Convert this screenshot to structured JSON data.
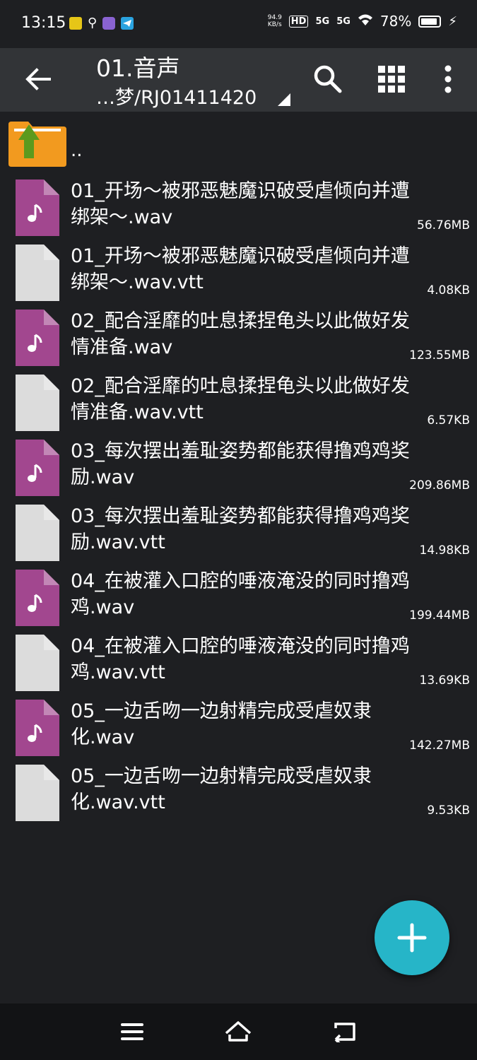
{
  "status_bar": {
    "time": "13:15",
    "net_speed_value": "94.9",
    "net_speed_unit": "KB/s",
    "hd_label": "HD",
    "sim1_label": "5G",
    "sim2_label": "5G",
    "battery": "78%"
  },
  "toolbar": {
    "title": "01.音声",
    "path": "…梦/RJ01411420"
  },
  "parent_dir": {
    "label": ".."
  },
  "files": [
    {
      "type": "audio",
      "name": "01_开场～被邪恶魅魔识破受虐倾向并遭绑架～.wav",
      "size": "56.76MB"
    },
    {
      "type": "text",
      "name": "01_开场～被邪恶魅魔识破受虐倾向并遭绑架～.wav.vtt",
      "size": "4.08KB"
    },
    {
      "type": "audio",
      "name": "02_配合淫靡的吐息揉捏龟头以此做好发情准备.wav",
      "size": "123.55MB"
    },
    {
      "type": "text",
      "name": "02_配合淫靡的吐息揉捏龟头以此做好发情准备.wav.vtt",
      "size": "6.57KB"
    },
    {
      "type": "audio",
      "name": "03_每次摆出羞耻姿势都能获得撸鸡鸡奖励.wav",
      "size": "209.86MB"
    },
    {
      "type": "text",
      "name": "03_每次摆出羞耻姿势都能获得撸鸡鸡奖励.wav.vtt",
      "size": "14.98KB"
    },
    {
      "type": "audio",
      "name": "04_在被灌入口腔的唾液淹没的同时撸鸡鸡.wav",
      "size": "199.44MB"
    },
    {
      "type": "text",
      "name": "04_在被灌入口腔的唾液淹没的同时撸鸡鸡.wav.vtt",
      "size": "13.69KB"
    },
    {
      "type": "audio",
      "name": "05_一边舌吻一边射精完成受虐奴隶化.wav",
      "size": "142.27MB"
    },
    {
      "type": "text",
      "name": "05_一边舌吻一边射精完成受虐奴隶化.wav.vtt",
      "size": "9.53KB"
    }
  ],
  "colors": {
    "background": "#1e1f22",
    "toolbar": "#323437",
    "audio_icon": "#a2478f",
    "text_icon": "#dcdcdc",
    "fab": "#26b5c8",
    "folder": "#f29a1f",
    "folder_arrow": "#5c9a1e"
  },
  "icons": {
    "back": "arrow-left-icon",
    "search": "search-icon",
    "grid": "grid-view-icon",
    "more": "more-vert-icon",
    "fab": "plus-icon",
    "nav_menu": "menu-icon",
    "nav_home": "home-icon",
    "nav_back": "back-icon"
  }
}
